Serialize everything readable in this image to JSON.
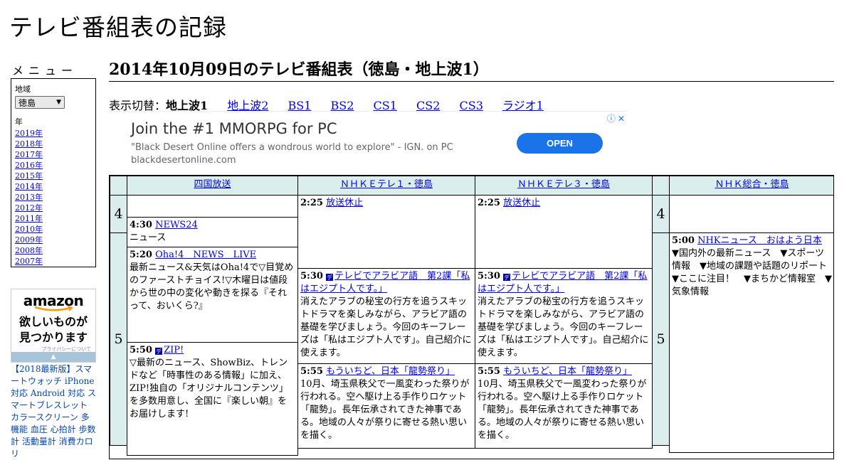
{
  "site_title": "テレビ番組表の記録",
  "menu": {
    "heading": "メニュー",
    "region_label": "地域",
    "region_value": "徳島",
    "year_label": "年",
    "years": [
      "2019年",
      "2018年",
      "2017年",
      "2016年",
      "2015年",
      "2014年",
      "2013年",
      "2012年",
      "2011年",
      "2010年",
      "2009年",
      "2008年",
      "2007年"
    ]
  },
  "amazon_ad": {
    "logo": "amazon",
    "copy_line1": "欲しいものが",
    "copy_line2": "見つかります",
    "privacy": "プライバシーについて",
    "product_text": "【2018最新版】スマートウォッチ iPhone 対応 Android 対応 スマートブレスレット カラースクリーン 多機能 血圧 心拍計 歩数計 活動量計 消費カロリ"
  },
  "page_heading": "2014年10月09日のテレビ番組表（徳島・地上波1）",
  "switcher": {
    "label": "表示切替：",
    "current": "地上波1",
    "links": [
      "地上波2",
      "BS1",
      "BS2",
      "CS1",
      "CS2",
      "CS3",
      "ラジオ1"
    ]
  },
  "banner": {
    "title": "Join the #1 MMORPG for PC",
    "description": "\"Black Desert Online offers a wondrous world to explore\" - IGN. on PC",
    "domain": "blackdesertonline.com",
    "button": "OPEN",
    "info_icon": "ⓘ",
    "close_icon": "✕"
  },
  "schedule": {
    "channels": [
      "四国放送",
      "ＮＨＫＥテレ１・徳島",
      "ＮＨＫＥテレ３・徳島",
      "ＮＨＫ総合・徳島"
    ],
    "hours": [
      "4",
      "5"
    ],
    "ch1": [
      {
        "time": "4:30",
        "title": "NEWS24",
        "desc": "ニュース"
      },
      {
        "time": "5:20",
        "title": "Oha!4　NEWS　LIVE",
        "desc": "最新ニュース&天気はOha!4で▽目覚めのファーストチョイス!▽木曜日は値段から世の中の変化や動きを探る『それって、おいくら?』"
      },
      {
        "time": "5:50",
        "title": "ZIP!",
        "desc": "▽最新のニュース、ShowBiz、トレンドなど「時事性のある情報」に加え、ZIP!独自の「オリジナルコンテンツ」を多数用意し、全国に『楽しい朝』をお届けします!"
      }
    ],
    "ch2": [
      {
        "time": "2:25",
        "title": "放送休止",
        "desc": ""
      },
      {
        "time": "5:30",
        "title": "テレビでアラビア語　第2課「私はエジプト人です。」",
        "desc": "消えたアラブの秘宝の行方を追うスキットドラマを楽しみながら、アラビア語の基礎を学びましょう。今回のキーフレーズは「私はエジプト人です」。自己紹介に使えます。"
      },
      {
        "time": "5:55",
        "title": "もういちど、日本「龍勢祭り」",
        "desc": "10月、埼玉県秩父で一風変わった祭りが行われる。空へ駆け上る手作りロケット「龍勢」。長年伝承されてきた神事である。地域の人々が祭りに寄せる熱い思いを描く。"
      }
    ],
    "ch3": [
      {
        "time": "2:25",
        "title": "放送休止",
        "desc": ""
      },
      {
        "time": "5:30",
        "title": "テレビでアラビア語　第2課「私はエジプト人です。」",
        "desc": "消えたアラブの秘宝の行方を追うスキットドラマを楽しみながら、アラビア語の基礎を学びましょう。今回のキーフレーズは「私はエジプト人です」。自己紹介に使えます。"
      },
      {
        "time": "5:55",
        "title": "もういちど、日本「龍勢祭り」",
        "desc": "10月、埼玉県秩父で一風変わった祭りが行われる。空へ駆け上る手作りロケット「龍勢」。長年伝承されてきた神事である。地域の人々が祭りに寄せる熱い思いを描く。"
      }
    ],
    "ch4": [
      {
        "time": "5:00",
        "title": "NHKニュース　おはよう日本",
        "desc": "▼国内外の最新ニュース　▼スポーツ情報　▼地域の課題や話題のリポート　▼ここに注目！　▼まちかど情報室　▼気象情報"
      }
    ]
  }
}
